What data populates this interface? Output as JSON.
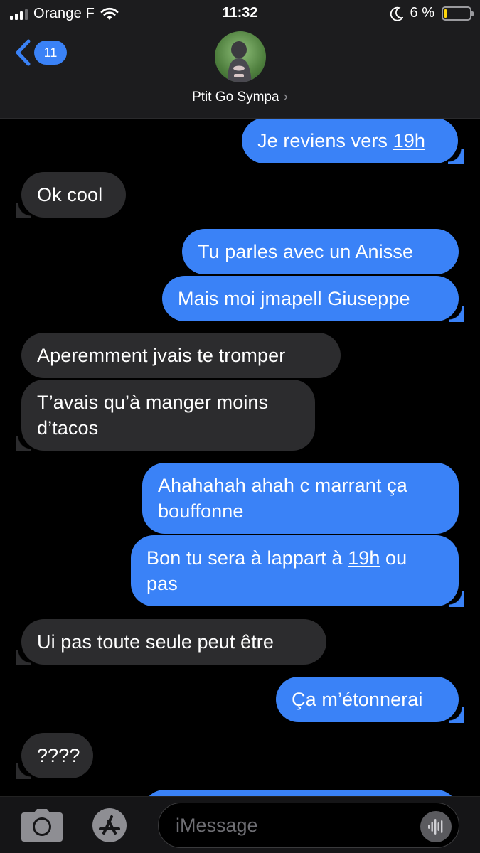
{
  "status_bar": {
    "carrier": "Orange F",
    "time": "11:32",
    "battery": "6 %",
    "battery_level": 0.06
  },
  "header": {
    "unread_count": "11",
    "contact_name": "Ptit Go Sympa",
    "chevron": "›"
  },
  "messages": [
    {
      "dir": "out",
      "parts": [
        "Je reviens vers ",
        "19h",
        ""
      ]
    },
    {
      "dir": "in",
      "text": "Ok cool"
    },
    {
      "dir": "out",
      "text": "Tu parles avec un Anisse"
    },
    {
      "dir": "out",
      "text": "Mais moi jmapell Giuseppe"
    },
    {
      "dir": "in",
      "text": "Aperemment jvais te tromper"
    },
    {
      "dir": "in",
      "text": "T’avais qu’à manger moins d’tacos"
    },
    {
      "dir": "out",
      "text": "Ahahahah ahah c marrant ça bouffonne"
    },
    {
      "dir": "out",
      "parts": [
        "Bon tu sera à lappart à ",
        "19h",
        " ou pas"
      ]
    },
    {
      "dir": "in",
      "text": "Ui pas toute seule peut être"
    },
    {
      "dir": "out",
      "text": "Ça m’étonnerai"
    },
    {
      "dir": "in",
      "text": "????"
    }
  ],
  "input": {
    "placeholder": "iMessage"
  },
  "icons": {
    "back": "chevron-left-icon",
    "camera": "camera-icon",
    "apps": "app-store-icon",
    "audio": "waveform-icon",
    "moon": "moon-icon",
    "wifi": "wifi-icon"
  },
  "colors": {
    "outgoing_bubble": "#3a82f7",
    "incoming_bubble": "#2c2c2e",
    "background": "#000000"
  }
}
